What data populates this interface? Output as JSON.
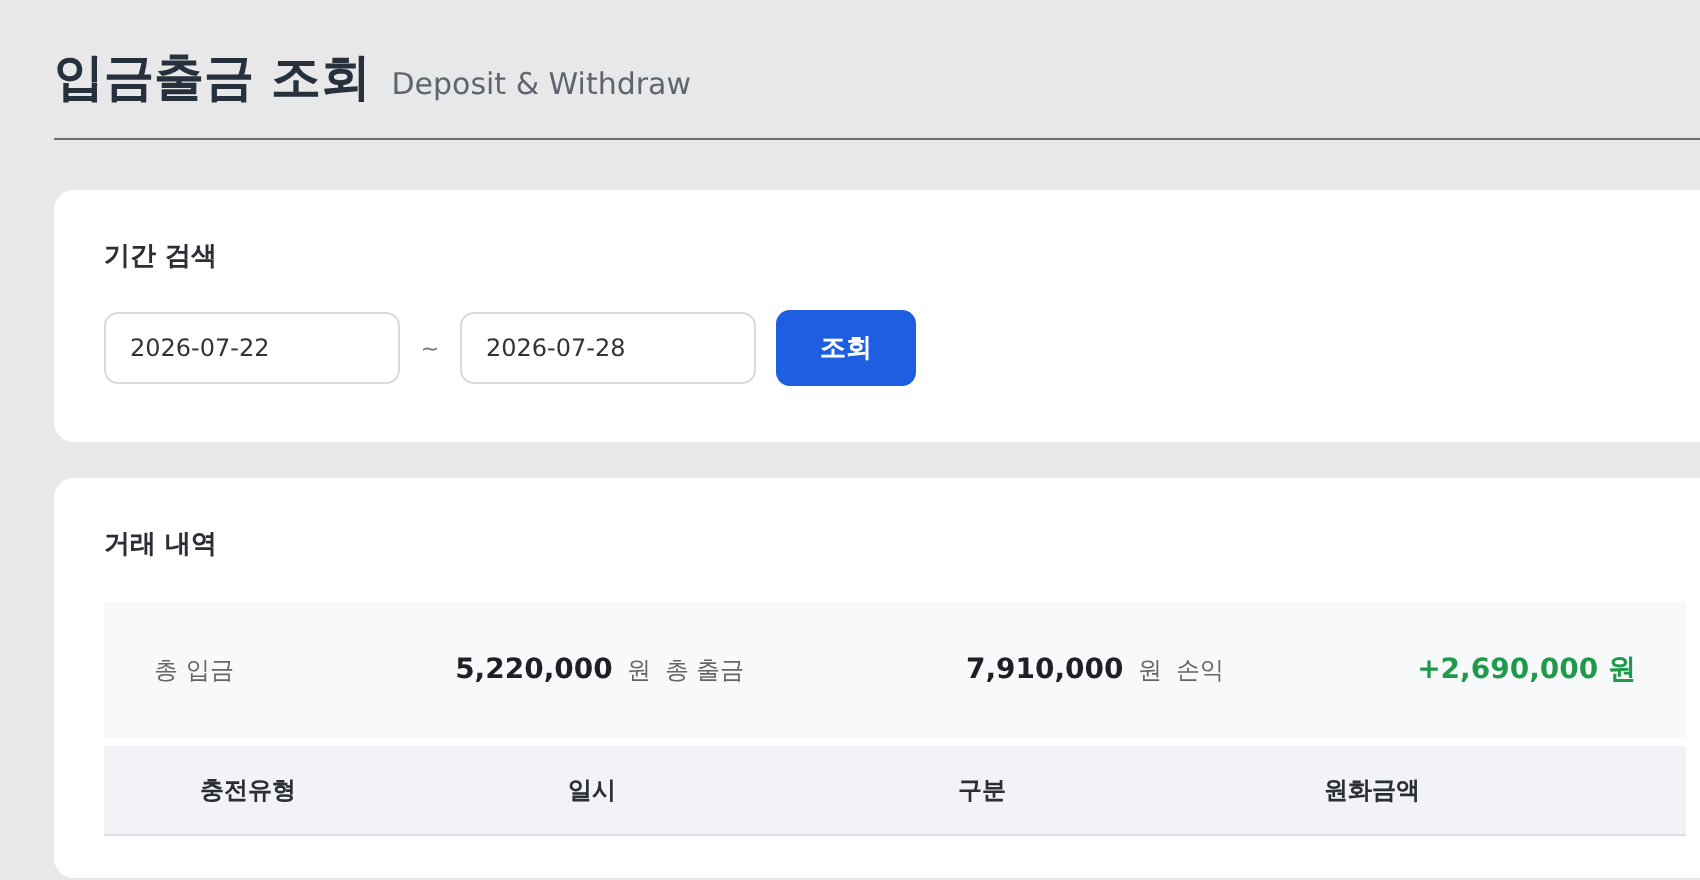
{
  "page": {
    "title": "입금출금 조회",
    "subtitle": "Deposit & Withdraw"
  },
  "search": {
    "heading": "기간 검색",
    "start_date": "2026-07-22",
    "separator": "~",
    "end_date": "2026-07-28",
    "button": "조회"
  },
  "history": {
    "heading": "거래 내역",
    "summary": [
      {
        "kind": "amount",
        "label": "총 입금",
        "value": "5,220,000",
        "unit": "원"
      },
      {
        "kind": "amount",
        "label": "총 출금",
        "value": "7,910,000",
        "unit": "원"
      },
      {
        "kind": "profit",
        "label": "손익",
        "value": "+2,690,000 원"
      }
    ],
    "columns": [
      "충전유형",
      "일시",
      "구분",
      "원화금액"
    ]
  }
}
